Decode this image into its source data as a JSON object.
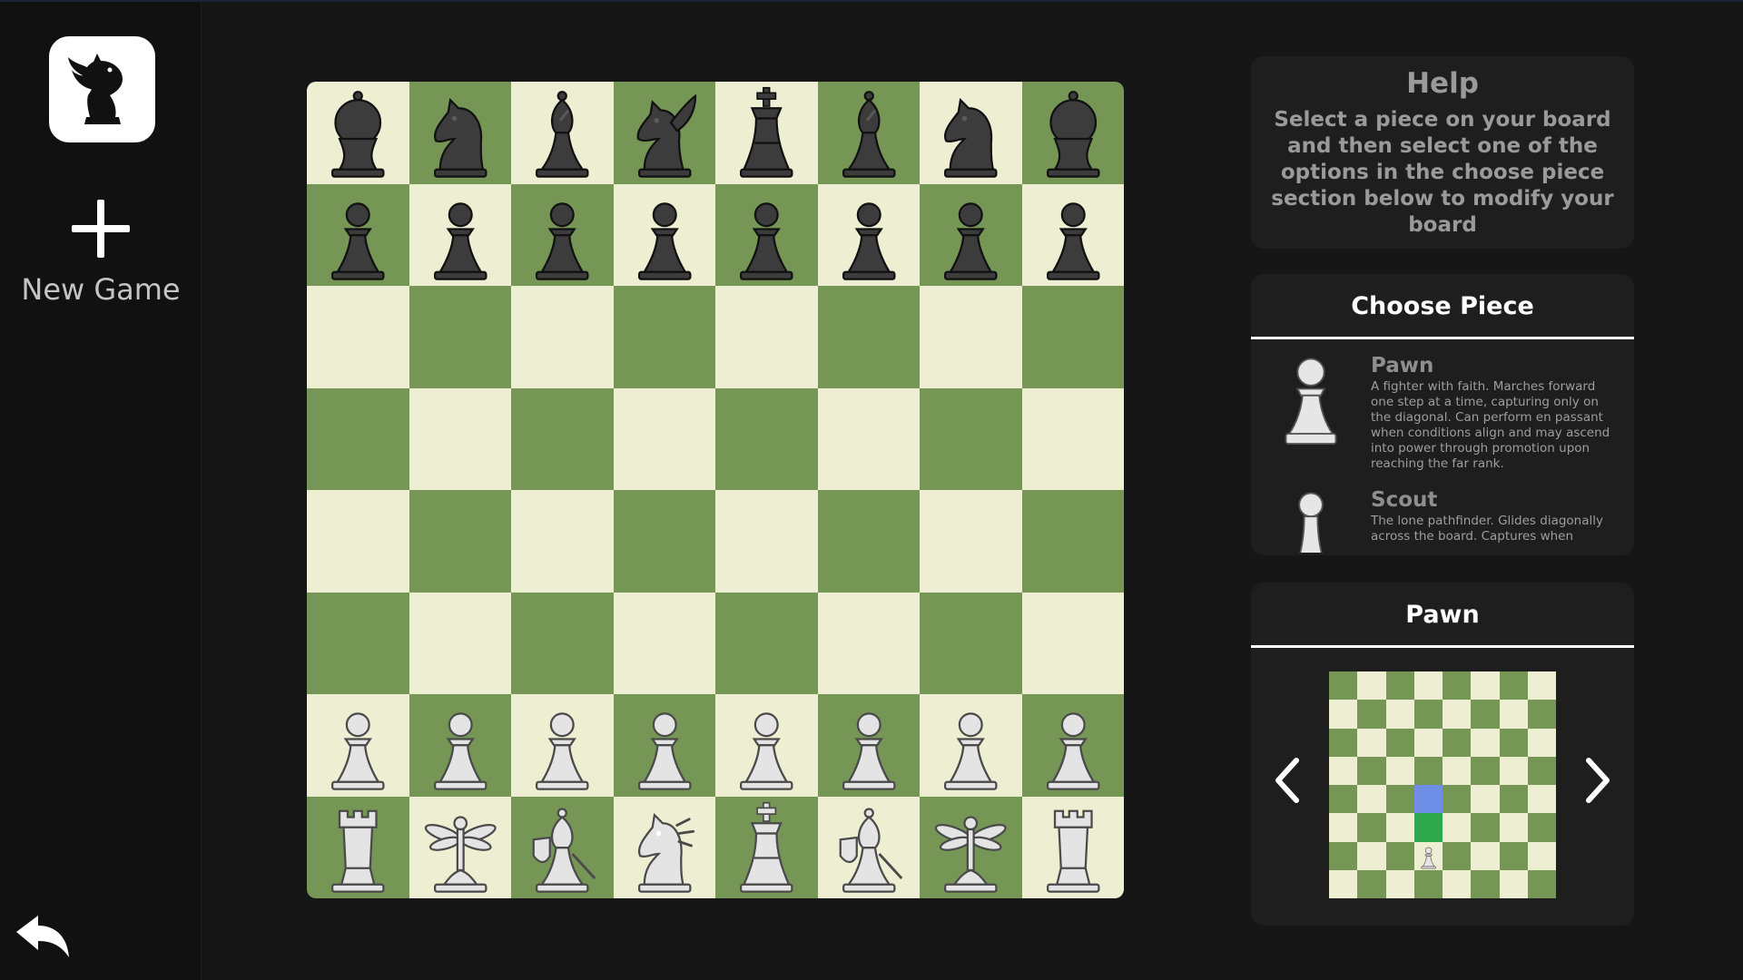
{
  "sidebar": {
    "new_game_label": "New Game"
  },
  "help": {
    "title": "Help",
    "text": "Select a piece on your board and then select one of the options in the choose piece section below to modify your board"
  },
  "choose_piece": {
    "title": "Choose Piece",
    "items": [
      {
        "name": "Pawn",
        "icon": "pawn-icon",
        "description": "A fighter with faith. Marches forward one step at a time, capturing only on the diagonal. Can perform en passant when conditions align and may ascend into power through promotion upon reaching the far rank."
      },
      {
        "name": "Scout",
        "icon": "scout-icon",
        "description": "The lone pathfinder. Glides diagonally across the board. Captures when"
      }
    ]
  },
  "preview": {
    "title": "Pawn",
    "highlights": [
      {
        "row": 4,
        "col": 3,
        "color": "#6f8ee6"
      },
      {
        "row": 5,
        "col": 3,
        "color": "#2ea84a"
      }
    ],
    "piece": {
      "row": 6,
      "col": 3,
      "type": "pawn"
    }
  },
  "board": {
    "light_color": "#eeeed2",
    "dark_color": "#769656",
    "ranks": [
      [
        "bD",
        "bN",
        "bB",
        "bG",
        "bK",
        "bB",
        "bN",
        "bD"
      ],
      [
        "bP",
        "bP",
        "bP",
        "bP",
        "bP",
        "bP",
        "bP",
        "bP"
      ],
      [
        "",
        "",
        "",
        "",
        "",
        "",
        "",
        ""
      ],
      [
        "",
        "",
        "",
        "",
        "",
        "",
        "",
        ""
      ],
      [
        "",
        "",
        "",
        "",
        "",
        "",
        "",
        ""
      ],
      [
        "",
        "",
        "",
        "",
        "",
        "",
        "",
        ""
      ],
      [
        "wP",
        "wP",
        "wP",
        "wP",
        "wP",
        "wP",
        "wP",
        "wP"
      ],
      [
        "wR",
        "wF",
        "wS",
        "wH",
        "wK",
        "wS",
        "wF",
        "wR"
      ]
    ],
    "piece_names": {
      "P": "pawn",
      "D": "orb-pawn",
      "N": "knight",
      "B": "bishop",
      "G": "pegasus",
      "K": "king",
      "R": "rook",
      "F": "dragonfly",
      "S": "shield-bishop",
      "H": "dragon-knight"
    }
  }
}
